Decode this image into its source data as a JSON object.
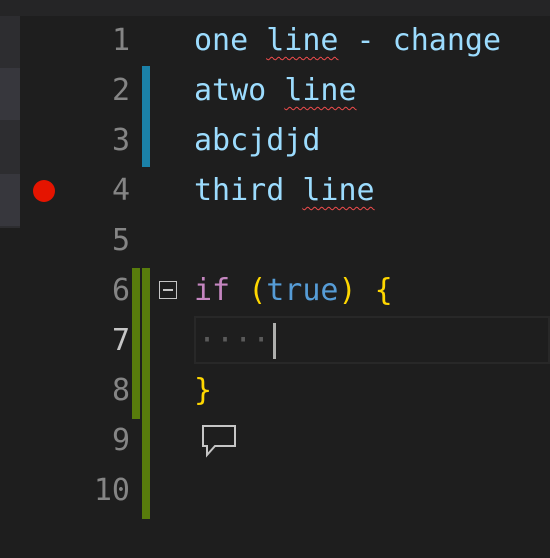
{
  "editor": {
    "lines": [
      {
        "number": "1",
        "text": "one line - change"
      },
      {
        "number": "2",
        "text": "atwo line"
      },
      {
        "number": "3",
        "text": "abcjdjd"
      },
      {
        "number": "4",
        "text": "third line"
      },
      {
        "number": "5",
        "text": ""
      },
      {
        "number": "6",
        "text": "if (true) {",
        "tokens": {
          "keyword": "if",
          "open_paren": "(",
          "literal": "true",
          "close_paren": ")",
          "open_brace": "{"
        }
      },
      {
        "number": "7",
        "text": "    ",
        "whitespace": "····"
      },
      {
        "number": "8",
        "text": "}"
      },
      {
        "number": "9",
        "text": ""
      },
      {
        "number": "10",
        "text": ""
      }
    ],
    "line1": {
      "word1": "one",
      "squiggle": "line",
      "rest": " - change"
    },
    "line2": {
      "word1": "atwo",
      "squiggle": "line"
    },
    "line4": {
      "word1": "third",
      "squiggle": "line"
    },
    "active_line": "7",
    "breakpoint_line": "4",
    "folding_line": "6",
    "comment_icon_line": "9"
  },
  "icons": {
    "breakpoint": "breakpoint-dot-icon",
    "fold": "fold-collapse-icon",
    "comment": "comment-bubble-icon"
  },
  "colors": {
    "background": "#1e1e1e",
    "line_number": "#858585",
    "line_number_active": "#c6c6c6",
    "identifier": "#9cdcfe",
    "keyword": "#c586c0",
    "literal": "#569cd6",
    "brace": "#ffd700",
    "breakpoint": "#e51400",
    "modified_gutter": "#1b81a8",
    "added_gutter": "#587c0c",
    "squiggle": "#f14c4c"
  }
}
